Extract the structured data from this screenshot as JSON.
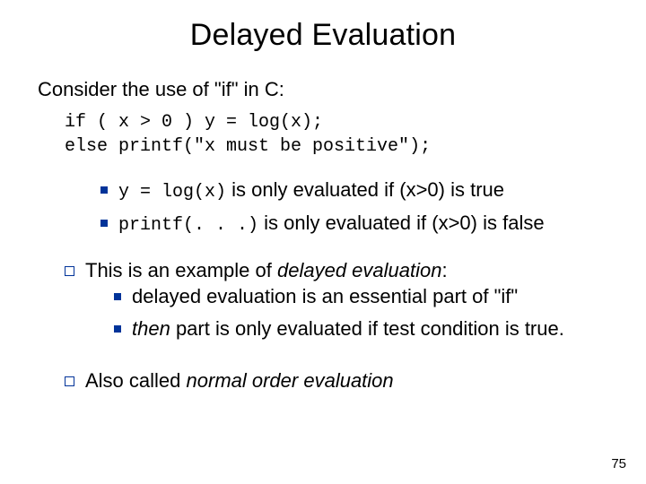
{
  "title": "Delayed Evaluation",
  "intro": "Consider the use of \"if\" in C:",
  "code": "if ( x > 0 ) y = log(x);\nelse printf(\"x must be positive\");",
  "b1": {
    "code": "y = log(x)",
    "rest": " is only evaluated if (x>0) is true"
  },
  "b2": {
    "code": "printf(. . .)",
    "rest": " is only evaluated if (x>0) is false"
  },
  "p1": {
    "pre": "This is an example of ",
    "em": "delayed evaluation",
    "post": ":"
  },
  "p1a": "delayed evaluation is an essential part of \"if\"",
  "p1b": {
    "em": "then",
    "rest": " part is only evaluated if test condition is true."
  },
  "p2": {
    "pre": "Also called ",
    "em": "normal order evaluation"
  },
  "page": "75"
}
